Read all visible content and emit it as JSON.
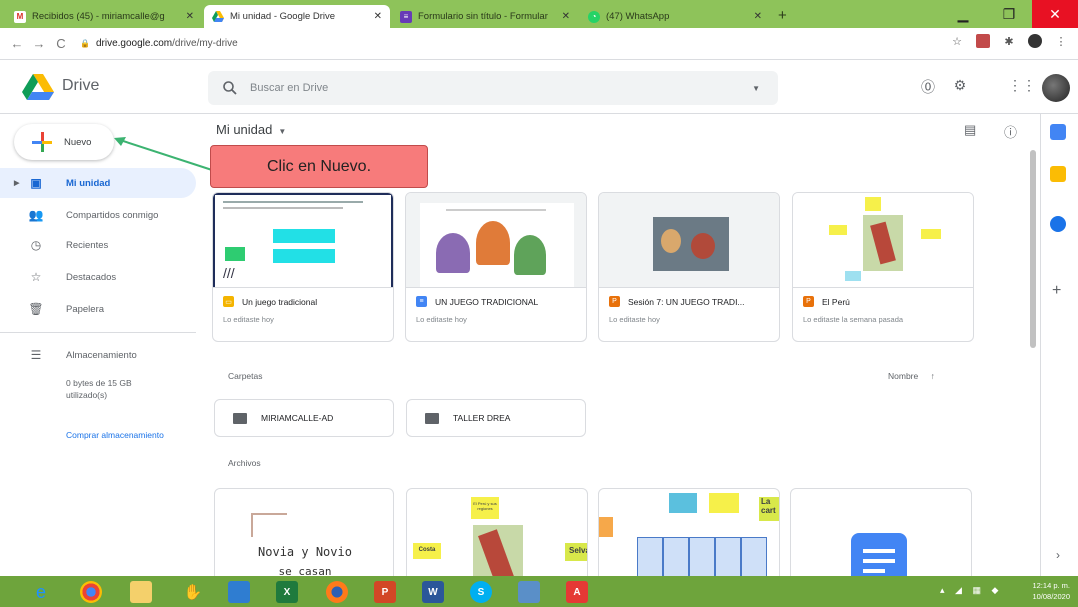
{
  "browser": {
    "tabs": [
      {
        "label": "Recibidos (45) - miriamcalle@g",
        "icon": "gmail-icon"
      },
      {
        "label": "Mi unidad - Google Drive",
        "icon": "drive-icon",
        "active": true
      },
      {
        "label": "Formulario sin título - Formular",
        "icon": "forms-icon"
      },
      {
        "label": "(47) WhatsApp",
        "icon": "whatsapp-icon"
      }
    ],
    "new_tab": "+",
    "url_host": "drive.google.com",
    "url_path": "/drive/my-drive"
  },
  "drive": {
    "logo_text": "Drive",
    "search_placeholder": "Buscar en Drive",
    "new_button": "Nuevo",
    "nav": [
      {
        "label": "Mi unidad",
        "icon": "my-drive-icon"
      },
      {
        "label": "Compartidos conmigo",
        "icon": "shared-icon"
      },
      {
        "label": "Recientes",
        "icon": "clock-icon"
      },
      {
        "label": "Destacados",
        "icon": "star-icon"
      },
      {
        "label": "Papelera",
        "icon": "trash-icon"
      },
      {
        "label": "Almacenamiento",
        "icon": "storage-icon"
      }
    ],
    "storage_usage": "0 bytes de 15 GB utilizado(s)",
    "buy_storage": "Comprar almacenamiento",
    "main_title": "Mi unidad",
    "callout": "Clic en Nuevo.",
    "quick_access": [
      {
        "name": "Un juego tradicional",
        "sub": "Lo editaste hoy",
        "type": "slides",
        "color": "#f4b400"
      },
      {
        "name": "UN JUEGO TRADICIONAL",
        "sub": "Lo editaste hoy",
        "type": "docs",
        "color": "#4285f4"
      },
      {
        "name": "Sesión 7: UN JUEGO TRADI...",
        "sub": "Lo editaste hoy",
        "type": "pptx",
        "color": "#e8710a"
      },
      {
        "name": "El Perú",
        "sub": "Lo editaste la semana pasada",
        "type": "pptx",
        "color": "#e8710a"
      }
    ],
    "folders_label": "Carpetas",
    "sort_label": "Nombre",
    "folders": [
      {
        "name": "MIRIAMCALLE-AD",
        "shared": true
      },
      {
        "name": "TALLER DREA",
        "shared": false
      }
    ],
    "files_label": "Archivos",
    "file_previews": {
      "novia_line1": "Novia y Novio",
      "novia_line2": "se casan"
    },
    "thumb_words": {
      "peru_labels": [
        "El Perú y sus regiones",
        "Costa",
        "Selva",
        "Sierra"
      ],
      "card3_labels": [
        "La cart"
      ]
    }
  },
  "taskbar": {
    "clock_time": "12:14 p. m.",
    "clock_date": "10/08/2020"
  },
  "colors": {
    "tab_strip": "#8ec35a",
    "taskbar": "#6ea43c",
    "callout": "#f77b7b",
    "active_nav": "#e8f0fe",
    "accent": "#1a73e8"
  }
}
